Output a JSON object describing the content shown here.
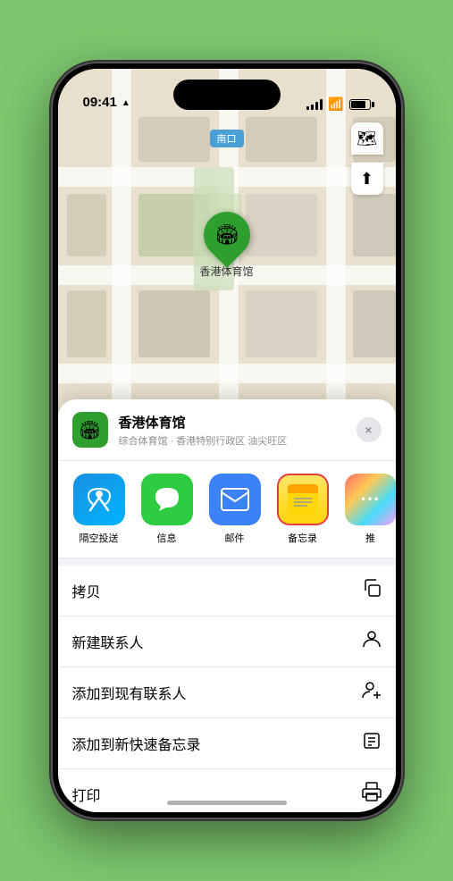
{
  "status": {
    "time": "09:41",
    "location_arrow": "▲"
  },
  "map": {
    "location_label": "南口",
    "pin_emoji": "🏟",
    "venue_name_pin": "香港体育馆"
  },
  "venue_card": {
    "icon_emoji": "🏟",
    "name": "香港体育馆",
    "description": "综合体育馆 · 香港特别行政区 油尖旺区",
    "close_label": "×"
  },
  "share_apps": [
    {
      "id": "airdrop",
      "label": "隔空投送",
      "emoji": "📡"
    },
    {
      "id": "messages",
      "label": "信息",
      "emoji": "💬"
    },
    {
      "id": "mail",
      "label": "邮件",
      "emoji": "✉️"
    },
    {
      "id": "notes",
      "label": "备忘录",
      "emoji": "📝"
    },
    {
      "id": "more",
      "label": "推",
      "emoji": "⋯"
    }
  ],
  "actions": [
    {
      "id": "copy",
      "label": "拷贝",
      "icon": "⎘"
    },
    {
      "id": "new-contact",
      "label": "新建联系人",
      "icon": "👤"
    },
    {
      "id": "add-existing",
      "label": "添加到现有联系人",
      "icon": "👤+"
    },
    {
      "id": "add-notes",
      "label": "添加到新快速备忘录",
      "icon": "🗒"
    },
    {
      "id": "print",
      "label": "打印",
      "icon": "🖨"
    }
  ]
}
